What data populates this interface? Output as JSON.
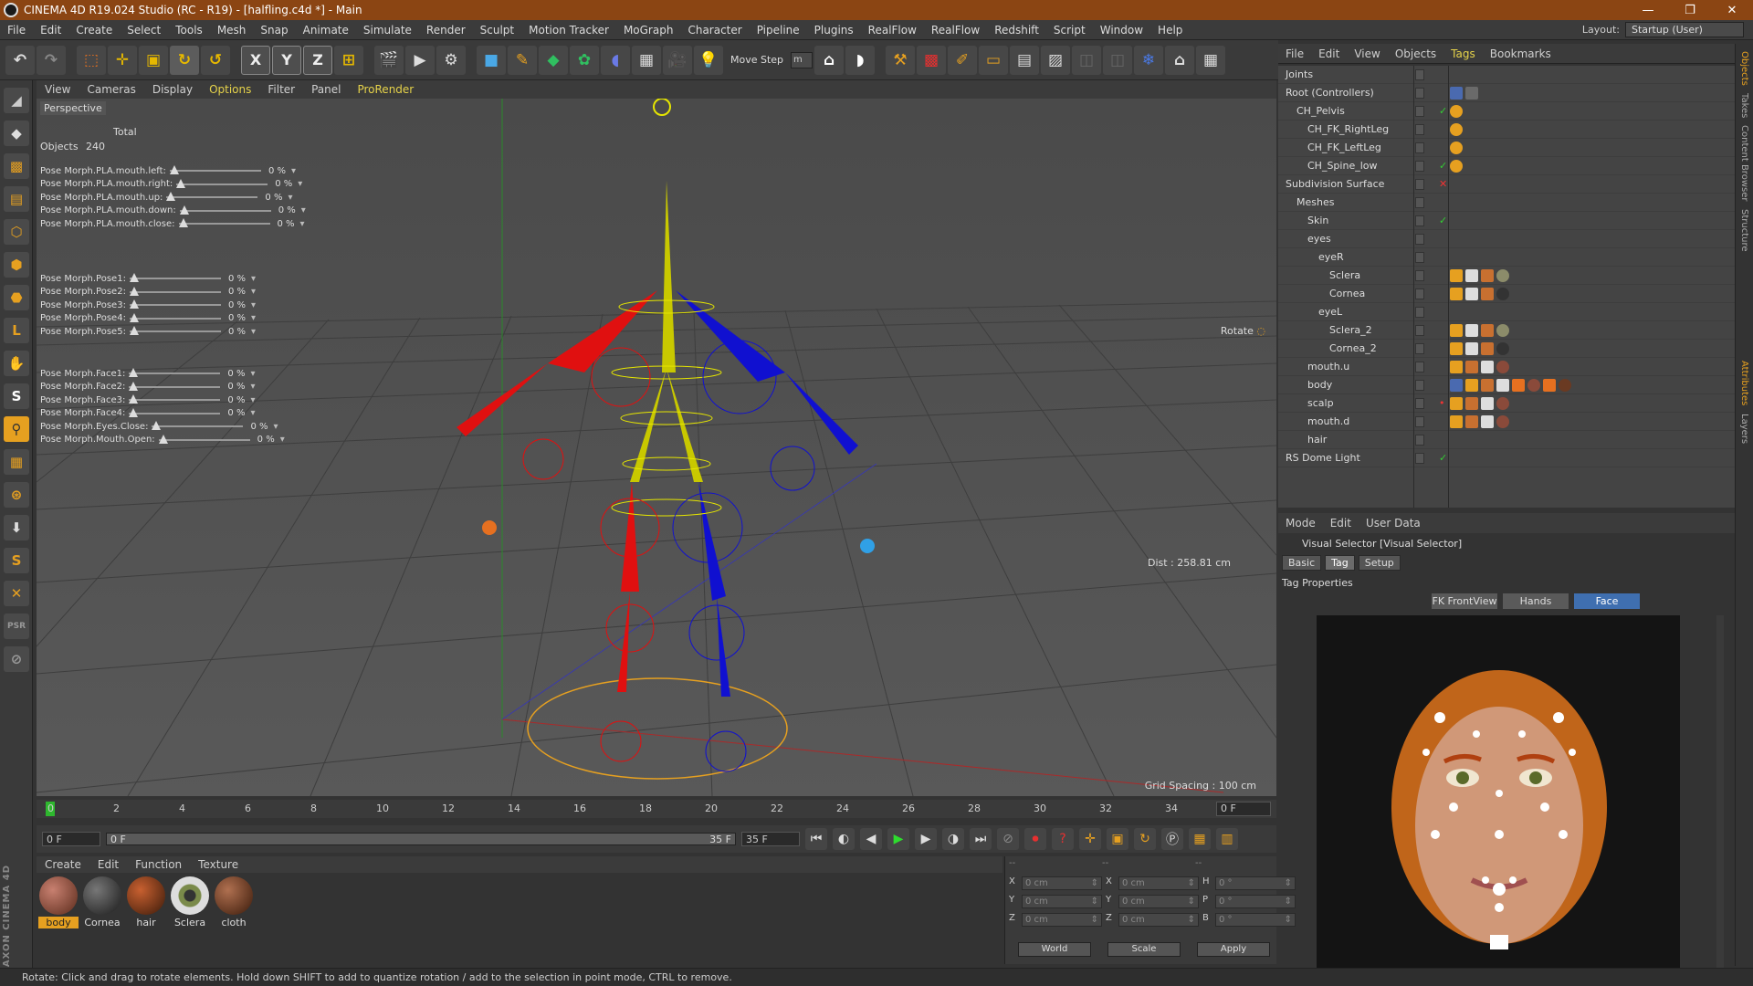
{
  "window": {
    "title": "CINEMA 4D R19.024 Studio (RC - R19) - [halfling.c4d *] - Main",
    "controls": [
      "—",
      "❐",
      "✕"
    ]
  },
  "menubar": {
    "items": [
      "File",
      "Edit",
      "Create",
      "Select",
      "Tools",
      "Mesh",
      "Snap",
      "Animate",
      "Simulate",
      "Render",
      "Sculpt",
      "Motion Tracker",
      "MoGraph",
      "Character",
      "Pipeline",
      "Plugins",
      "RealFlow",
      "RealFlow",
      "Redshift",
      "Script",
      "Window",
      "Help"
    ],
    "layout_label": "Layout:",
    "layout_value": "Startup (User)"
  },
  "toolbar": {
    "move_step_label": "Move Step",
    "move_step_value": "m"
  },
  "viewport": {
    "menu": [
      "View",
      "Cameras",
      "Display",
      "Options",
      "Filter",
      "Panel",
      "ProRender"
    ],
    "camera_label": "Perspective",
    "stats_total": "Total",
    "stats_objects_label": "Objects",
    "stats_objects_value": "240",
    "rotate_label": "Rotate",
    "dist_label": "Dist : 258.81 cm",
    "grid_label": "Grid Spacing : 100 cm",
    "slider_group_1": [
      {
        "label": "Pose Morph.PLA.mouth.left:",
        "value": "0 %"
      },
      {
        "label": "Pose Morph.PLA.mouth.right:",
        "value": "0 %"
      },
      {
        "label": "Pose Morph.PLA.mouth.up:",
        "value": "0 %"
      },
      {
        "label": "Pose Morph.PLA.mouth.down:",
        "value": "0 %"
      },
      {
        "label": "Pose Morph.PLA.mouth.close:",
        "value": "0 %"
      }
    ],
    "slider_group_2": [
      {
        "label": "Pose Morph.Pose1:",
        "value": "0 %"
      },
      {
        "label": "Pose Morph.Pose2:",
        "value": "0 %"
      },
      {
        "label": "Pose Morph.Pose3:",
        "value": "0 %"
      },
      {
        "label": "Pose Morph.Pose4:",
        "value": "0 %"
      },
      {
        "label": "Pose Morph.Pose5:",
        "value": "0 %"
      }
    ],
    "slider_group_3": [
      {
        "label": "Pose Morph.Face1:",
        "value": "0 %"
      },
      {
        "label": "Pose Morph.Face2:",
        "value": "0 %"
      },
      {
        "label": "Pose Morph.Face3:",
        "value": "0 %"
      },
      {
        "label": "Pose Morph.Face4:",
        "value": "0 %"
      },
      {
        "label": "Pose Morph.Eyes.Close:",
        "value": "0 %"
      },
      {
        "label": "Pose Morph.Mouth.Open:",
        "value": "0 %"
      }
    ]
  },
  "timeline": {
    "ticks": [
      "0",
      "2",
      "4",
      "6",
      "8",
      "10",
      "12",
      "14",
      "16",
      "18",
      "20",
      "22",
      "24",
      "26",
      "28",
      "30",
      "32",
      "34"
    ],
    "current_frame": "0 F",
    "start_frame": "0 F",
    "range_start": "0 F",
    "range_end": "35 F",
    "end_frame": "35 F"
  },
  "materials": {
    "menu": [
      "Create",
      "Edit",
      "Function",
      "Texture"
    ],
    "items": [
      {
        "name": "body",
        "color": "#8a4a3a",
        "selected": true
      },
      {
        "name": "Cornea",
        "color": "#444444",
        "selected": false
      },
      {
        "name": "hair",
        "color": "#7a3a20",
        "selected": false
      },
      {
        "name": "Sclera",
        "color": "#8c8c6a",
        "selected": false
      },
      {
        "name": "cloth",
        "color": "#6a3a22",
        "selected": false
      }
    ]
  },
  "coordinates": {
    "header": [
      "--",
      "--",
      "--"
    ],
    "rows": [
      {
        "a": "X",
        "av": "0 cm",
        "b": "X",
        "bv": "0 cm",
        "c": "H",
        "cv": "0 °"
      },
      {
        "a": "Y",
        "av": "0 cm",
        "b": "Y",
        "bv": "0 cm",
        "c": "P",
        "cv": "0 °"
      },
      {
        "a": "Z",
        "av": "0 cm",
        "b": "Z",
        "bv": "0 cm",
        "c": "B",
        "cv": "0 °"
      }
    ],
    "world": "World",
    "scale": "Scale",
    "apply": "Apply"
  },
  "object_manager": {
    "menu": [
      "File",
      "Edit",
      "View",
      "Objects",
      "Tags",
      "Bookmarks"
    ],
    "objects": [
      {
        "name": "Joints",
        "indent": 0
      },
      {
        "name": "Root (Controllers)",
        "indent": 0
      },
      {
        "name": "CH_Pelvis",
        "indent": 1
      },
      {
        "name": "CH_FK_RightLeg",
        "indent": 2
      },
      {
        "name": "CH_FK_LeftLeg",
        "indent": 2
      },
      {
        "name": "CH_Spine_low",
        "indent": 2
      },
      {
        "name": "Subdivision Surface",
        "indent": 0
      },
      {
        "name": "Meshes",
        "indent": 1
      },
      {
        "name": "Skin",
        "indent": 2
      },
      {
        "name": "eyes",
        "indent": 2
      },
      {
        "name": "eyeR",
        "indent": 3
      },
      {
        "name": "Sclera",
        "indent": 4
      },
      {
        "name": "Cornea",
        "indent": 4
      },
      {
        "name": "eyeL",
        "indent": 3
      },
      {
        "name": "Sclera_2",
        "indent": 4
      },
      {
        "name": "Cornea_2",
        "indent": 4
      },
      {
        "name": "mouth.u",
        "indent": 2
      },
      {
        "name": "body",
        "indent": 2
      },
      {
        "name": "scalp",
        "indent": 2
      },
      {
        "name": "mouth.d",
        "indent": 2
      },
      {
        "name": "hair",
        "indent": 2
      },
      {
        "name": "RS Dome Light",
        "indent": 0
      }
    ]
  },
  "attributes": {
    "menu": [
      "Mode",
      "Edit",
      "User Data"
    ],
    "title": "Visual Selector [Visual Selector]",
    "tabs": [
      "Basic",
      "Tag",
      "Setup"
    ],
    "section": "Tag Properties",
    "face_tabs": [
      "FK FrontView",
      "Hands",
      "Face"
    ]
  },
  "right_strip": [
    "Objects",
    "Takes",
    "Content Browser",
    "Structure",
    "Attributes",
    "Layers"
  ],
  "status": "Rotate: Click and drag to rotate elements. Hold down SHIFT to add to quantize rotation / add to the selection in point mode, CTRL to remove."
}
